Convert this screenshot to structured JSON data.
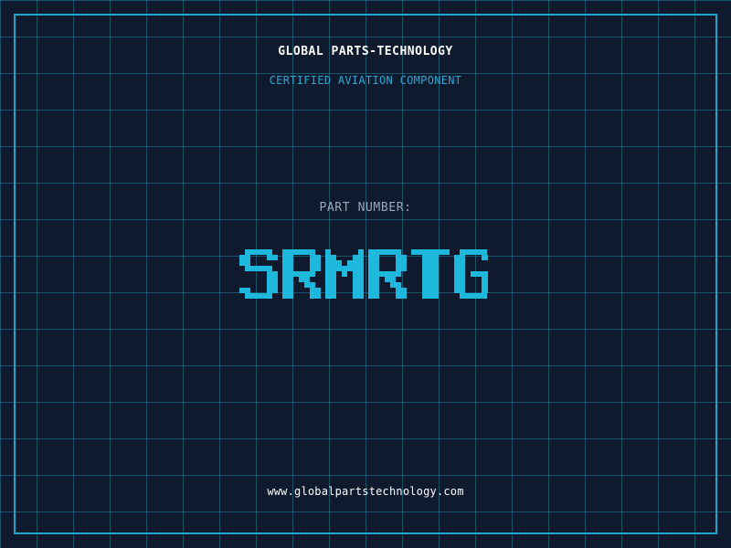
{
  "company_name": "GLOBAL PARTS-TECHNOLOGY",
  "tagline": "CERTIFIED AVIATION COMPONENT",
  "part_number_label": "PART NUMBER:",
  "part_number": "SRMRTG",
  "website": "www.globalpartstechnology.com",
  "colors": {
    "background": "#0f1a2e",
    "grid": "#2896af",
    "frame": "#1fa3c6",
    "accent": "#2aa9d4",
    "part_number": "#1db8dc"
  }
}
